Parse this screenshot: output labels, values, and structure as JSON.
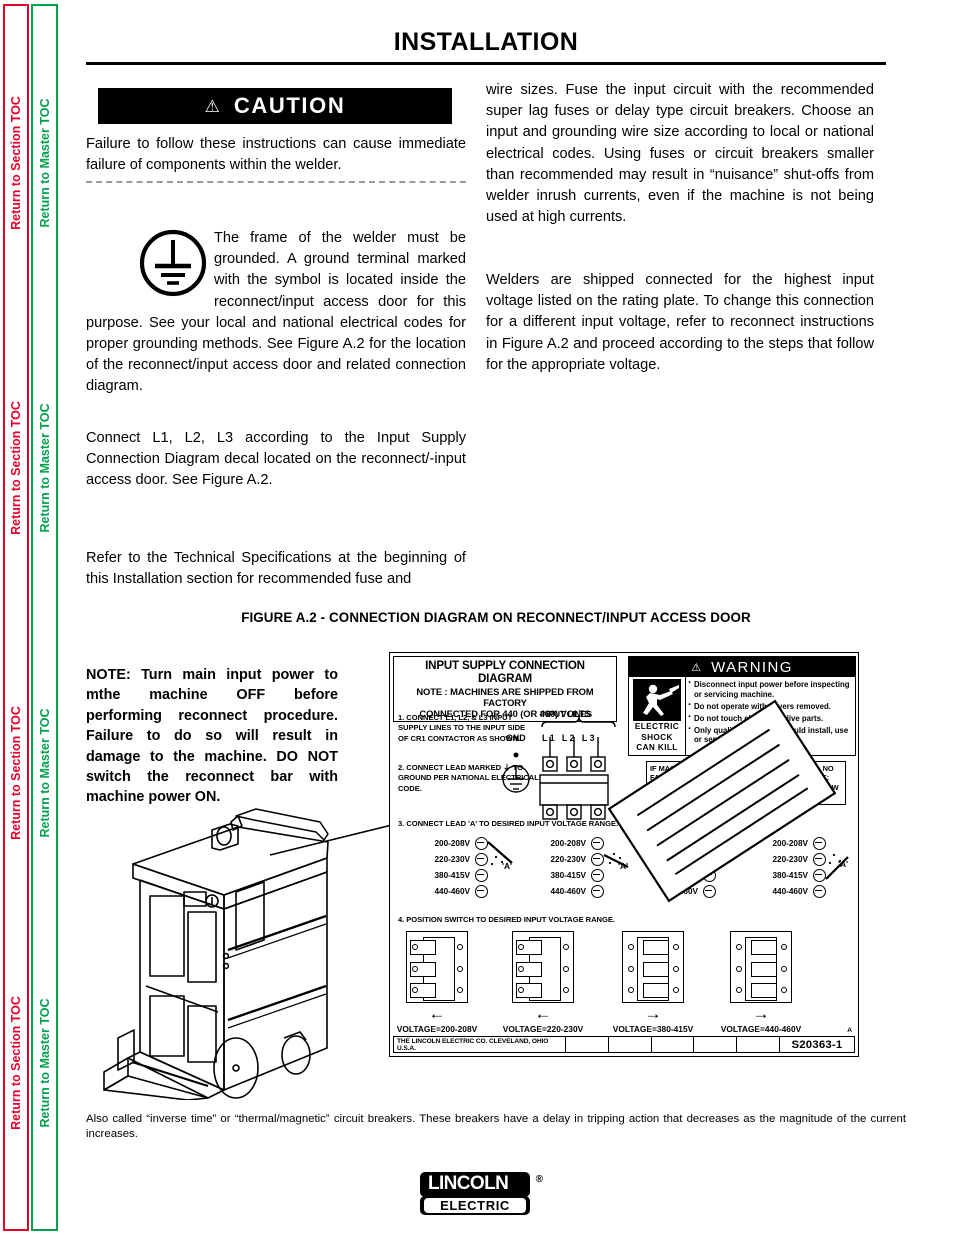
{
  "sidebar": {
    "section_toc_label": "Return to Section TOC",
    "master_toc_label": "Return to Master TOC",
    "colors": {
      "section": "#e4022a",
      "master": "#00a14b"
    }
  },
  "page": {
    "title": "INSTALLATION"
  },
  "caution": {
    "icon": "warning-triangle-icon",
    "label": "CAUTION",
    "text": "Failure to follow these instructions can cause immediate failure of components within the welder."
  },
  "left_column": {
    "ground_icon": "protective-earth-ground-icon",
    "ground_paragraph": "The frame of the welder must be grounded. A ground terminal marked with the symbol is located inside the reconnect/input access door for this purpose. See your local and national electrical codes for proper grounding methods.  See Figure A.2 for the location of the reconnect/input access door and related connection diagram.",
    "connect_paragraph": "Connect L1, L2, L3 according to the Input Supply Connection Diagram decal located on the reconnect/-input access door.  See Figure A.2.",
    "refer_paragraph": "Refer to the Technical Specifications at the beginning of this Installation section for recommended fuse and"
  },
  "right_column": {
    "paragraph_1": "wire sizes.  Fuse the input circuit with the recommended super lag fuses or delay type circuit breakers. Choose an input and grounding wire size according to local or national electrical codes.  Using fuses or circuit breakers smaller than recommended may result in “nuisance” shut-offs from welder inrush currents, even if the machine is not being used at high currents.",
    "paragraph_2": "Welders are shipped connected for the highest input voltage listed on the rating plate.  To change this connection for a different input voltage, refer to reconnect instructions in Figure A.2 and proceed according to the steps that follow for the appropriate voltage."
  },
  "figure": {
    "caption": "FIGURE A.2 - CONNECTION DIAGRAM ON RECONNECT/INPUT ACCESS DOOR",
    "note": "NOTE: Turn main input power to mthe machine OFF before performing reconnect procedure.  Failure to do so will result in damage to the machine.   DO NOT switch the reconnect bar with machine power ON.",
    "welder_illustration": "welder-machine-illustration"
  },
  "decal": {
    "header_line_1": "INPUT SUPPLY CONNECTION DIAGRAM",
    "header_line_2": "NOTE :   MACHINES ARE SHIPPED FROM FACTORY",
    "header_line_3": "CONNECTED FOR 440 (OR 460) VOLTS",
    "step_1": "1. CONNECT L1, L2, & L3 INPUT SUPPLY LINES TO THE INPUT SIDE OF CR1 CONTACTOR AS SHOWN.",
    "step_2": "2. CONNECT LEAD MARKED ⏚ TO GROUND PER NATIONAL ELECTRICAL CODE.",
    "step_3": "3. CONNECT LEAD 'A' TO DESIRED INPUT VOLTAGE RANGE.",
    "step_4": "4. POSITION SWITCH TO DESIRED INPUT VOLTAGE RANGE.",
    "input_lines_label": "INPUT LINES",
    "gnd_label": "GND",
    "line_labels": "L1 L2 L3",
    "lead_a_label": "'A'",
    "voltage_ranges": [
      "200-208V",
      "220-230V",
      "380-415V",
      "440-460V"
    ],
    "switch_positions": [
      {
        "arrow": "←",
        "label": "VOLTAGE=200-208V"
      },
      {
        "arrow": "←",
        "label": "VOLTAGE=220-230V"
      },
      {
        "arrow": "→",
        "label": "VOLTAGE=380-415V"
      },
      {
        "arrow": "→",
        "label": "VOLTAGE=440-460V"
      }
    ],
    "warning": {
      "icon": "warning-triangle-icon",
      "title": "WARNING",
      "pictogram": "electric-shock-icon",
      "pictogram_caption_1": "ELECTRIC",
      "pictogram_caption_2": "SHOCK",
      "pictogram_caption_3": "CAN  KILL",
      "bullets": [
        "Disconnect input power  before inspecting or servicing machine.",
        "Do not operate with covers removed.",
        "Do not touch electrically live parts.",
        "Only qualified persons should install, use or service this equipment."
      ]
    },
    "fuse_note": "IF MACHINE CEASES TO OPERATE (NO METER, NO FAN) AND THERE IS NO OTHER KNOWN FAILURE:  CHECK FUSE; REPLACE WITH A 5 AMP SLOW BLOW ONLY.",
    "titleblock_company": "THE LINCOLN ELECTRIC CO.   CLEVELAND, OHIO  U.S.A.",
    "titleblock_number": "S20363-1",
    "revision": "A"
  },
  "footnote": {
    "text": "Also called “inverse time” or “thermal/magnetic” circuit breakers.  These breakers have a delay in tripping action that decreases as the magnitude of the current increases."
  },
  "logo": {
    "word_top": "LINCOLN",
    "registered_mark": "®",
    "word_bottom": "ELECTRIC"
  }
}
